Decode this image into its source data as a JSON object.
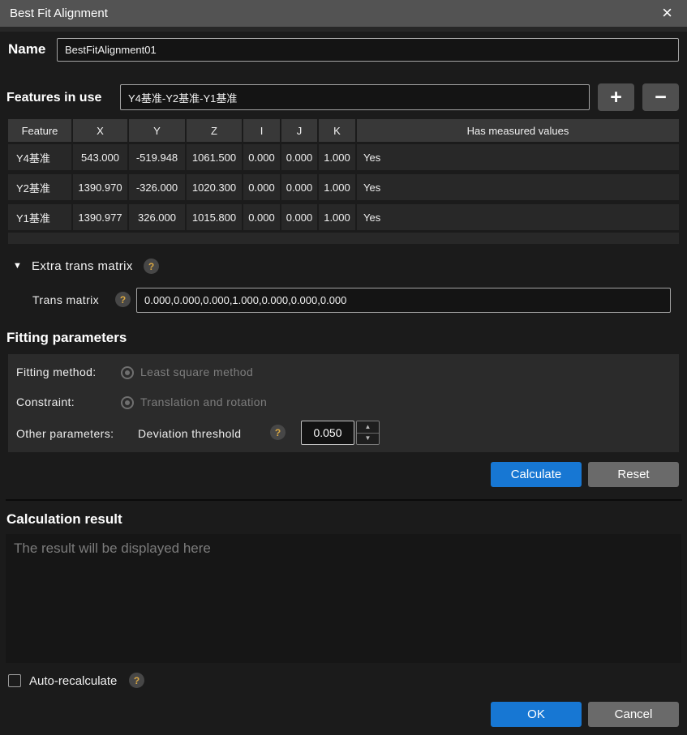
{
  "window": {
    "title": "Best Fit Alignment"
  },
  "icons": {
    "close": "×",
    "add": "+",
    "remove": "−",
    "collapse": "▼",
    "help": "?",
    "spin_up": "▲",
    "spin_down": "▼"
  },
  "name_row": {
    "label": "Name",
    "value": "BestFitAlignment01"
  },
  "features_row": {
    "label": "Features in use",
    "value": "Y4基准-Y2基准-Y1基准"
  },
  "table": {
    "columns": [
      "Feature",
      "X",
      "Y",
      "Z",
      "I",
      "J",
      "K",
      "Has measured values"
    ],
    "rows": [
      [
        "Y4基准",
        "543.000",
        "-519.948",
        "1061.500",
        "0.000",
        "0.000",
        "1.000",
        "Yes"
      ],
      [
        "Y2基准",
        "1390.970",
        "-326.000",
        "1020.300",
        "0.000",
        "0.000",
        "1.000",
        "Yes"
      ],
      [
        "Y1基准",
        "1390.977",
        "326.000",
        "1015.800",
        "0.000",
        "0.000",
        "1.000",
        "Yes"
      ]
    ]
  },
  "extra_trans": {
    "section_label": "Extra trans matrix",
    "matrix_label": "Trans matrix",
    "matrix_value": "0.000,0.000,0.000,1.000,0.000,0.000,0.000"
  },
  "fitting": {
    "section_label": "Fitting parameters",
    "method_label": "Fitting method:",
    "method_option": "Least square method",
    "constraint_label": "Constraint:",
    "constraint_option": "Translation and rotation",
    "other_label": "Other parameters:",
    "deviation_label": "Deviation threshold",
    "deviation_value": "0.050",
    "calculate_label": "Calculate",
    "reset_label": "Reset"
  },
  "result": {
    "section_label": "Calculation result",
    "placeholder": "The result will be displayed here"
  },
  "footer": {
    "auto_recalculate_label": "Auto-recalculate",
    "ok_label": "OK",
    "cancel_label": "Cancel"
  },
  "colors": {
    "accent_blue": "#1777d3",
    "button_gray": "#6a6a6a",
    "titlebar_gray": "#535353",
    "background": "#1b1b1b",
    "help_icon_yellow": "#d9a743"
  }
}
